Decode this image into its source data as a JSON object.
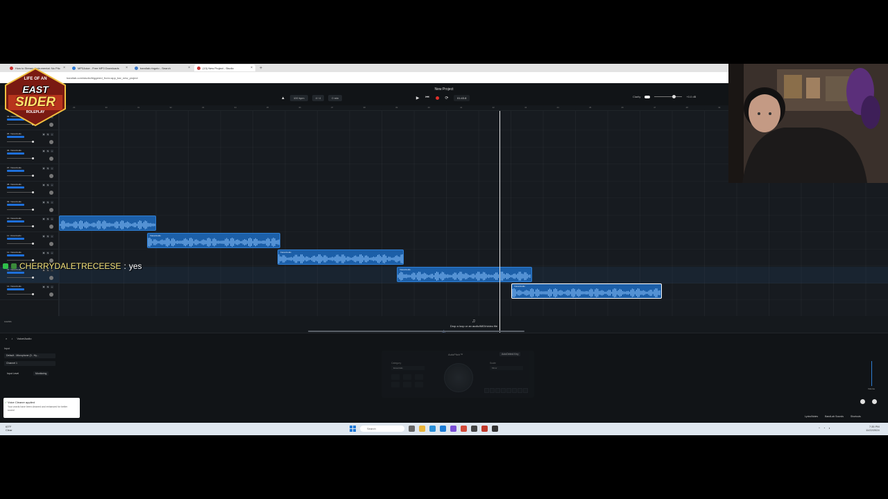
{
  "browser": {
    "tabs": [
      {
        "label": "How to Stream Instrumental: No Pitc",
        "active": false,
        "color": "#d0392b"
      },
      {
        "label": "MP3Juice - Free MP3 Downloads",
        "active": false,
        "color": "#2a7ad8"
      },
      {
        "label": "bandlab.ringoto - Search",
        "active": false,
        "color": "#3a78c8"
      },
      {
        "label": "(13) New Project - Studio",
        "active": true,
        "color": "#d0392b"
      }
    ],
    "address": "bandlab.com/studio/triggered_from=app_bar_new_project"
  },
  "studio": {
    "project_title": "New Project",
    "bpm": "100 bpm",
    "time_signature": "4 / 4",
    "key": "0 min",
    "timecode": "01:43.8",
    "clarity_label": "Clarity",
    "volume_readout": "+0.0 dB",
    "ruler_ticks": [
      "29",
      "30",
      "31",
      "32",
      "33",
      "34",
      "35",
      "36",
      "37",
      "38",
      "39",
      "40",
      "41",
      "42",
      "43",
      "44",
      "45",
      "46",
      "47",
      "48",
      "49",
      "50",
      "51",
      "52",
      "53",
      "54"
    ],
    "tracks": [
      {
        "name": "04. Voice/Audio",
        "badge": "AutoPitch"
      },
      {
        "name": "05. Voice/Audio",
        "badge": "AutoPitch"
      },
      {
        "name": "06. Voice/Audio",
        "badge": "AutoPitch"
      },
      {
        "name": "07. Voice/Audio",
        "badge": "AutoPitch"
      },
      {
        "name": "08. Voice/Audio",
        "badge": "AutoPitch"
      },
      {
        "name": "09. Voice/Audio",
        "badge": "AutoPitch"
      },
      {
        "name": "10. Voice/Audio",
        "badge": "AutoPitch"
      },
      {
        "name": "11. Voice/Audio",
        "badge": "AutoPitch"
      },
      {
        "name": "12. Voice/Audio",
        "badge": "AutoPitch"
      },
      {
        "name": "13. Voice/Audio",
        "badge": "AutoPitch",
        "selected": true
      },
      {
        "name": "14. Voice/Audio",
        "badge": "AutoPitch"
      }
    ],
    "clip_label": "Voice/Audio",
    "add_track_label": "AutoMix",
    "drop_hint": "Drop a loop or an audio/MIDI/video file",
    "bottom": {
      "track_name": "Voice/Audio",
      "input_label": "Input",
      "input_device": "Default - Microphone (3 - Hy...",
      "channel": "Channel 1",
      "input_level": "Input Level",
      "monitoring": "Monitoring",
      "effect_title": "AutoPitch™",
      "auto_detect": "AutoDetect Key",
      "category_label": "Category",
      "category_value": "Essentials",
      "scale_label": "Scale",
      "scale_value": "Minor",
      "volume_label": "Volume",
      "lyrics": "Lyrics/Notes",
      "sounds": "BandLab Sounds",
      "shortcuts": "Shortcuts"
    }
  },
  "toast": {
    "title": "Voice Cleaner applied",
    "body": "Your words have been cleaned and enhanced for better sound"
  },
  "overlay": {
    "logo": {
      "line1": "LIFE OF AN",
      "line2": "EAST",
      "line3": "SIDER",
      "line4": "ROLEPLAY"
    },
    "chat": {
      "user": "CHERRYDALETRECEESE",
      "separator": ":",
      "message": "yes"
    }
  },
  "taskbar": {
    "weather_temp": "63°F",
    "weather_desc": "Clear",
    "search_placeholder": "Search",
    "time": "7:35 PM",
    "date": "11/22/2024"
  }
}
